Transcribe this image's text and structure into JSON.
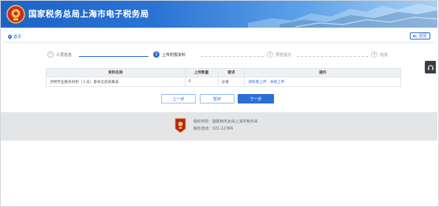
{
  "header": {
    "title": "国家税务总局上海市电子税务局"
  },
  "nav": {
    "home": "首页",
    "back": "返回"
  },
  "steps": [
    {
      "num": "✓",
      "label": "人员信息",
      "state": "done"
    },
    {
      "num": "2",
      "label": "上传附报资料",
      "state": "active"
    },
    {
      "num": "3",
      "label": "预览提交",
      "state": "todo"
    },
    {
      "num": "4",
      "label": "完成",
      "state": "todo"
    }
  ],
  "table": {
    "headers": [
      "资料名称",
      "上传数量",
      "要求",
      "操作"
    ],
    "rows": [
      {
        "name": "涉税专业服务机构（人员）基本信息采集表",
        "count": "0",
        "req": "必报",
        "op_upload": "资料库上传",
        "op_local": "本地上传"
      }
    ]
  },
  "buttons": {
    "prev": "上一步",
    "save": "暂存",
    "next": "下一步"
  },
  "footer": {
    "owner": "版权所有：国家税务总局上海市税务局",
    "phone": "服务电话：021-12366"
  },
  "colors": {
    "accent": "#2b6fd6",
    "header_start": "#1d63c8",
    "footer_bg": "#e4e5e7"
  }
}
